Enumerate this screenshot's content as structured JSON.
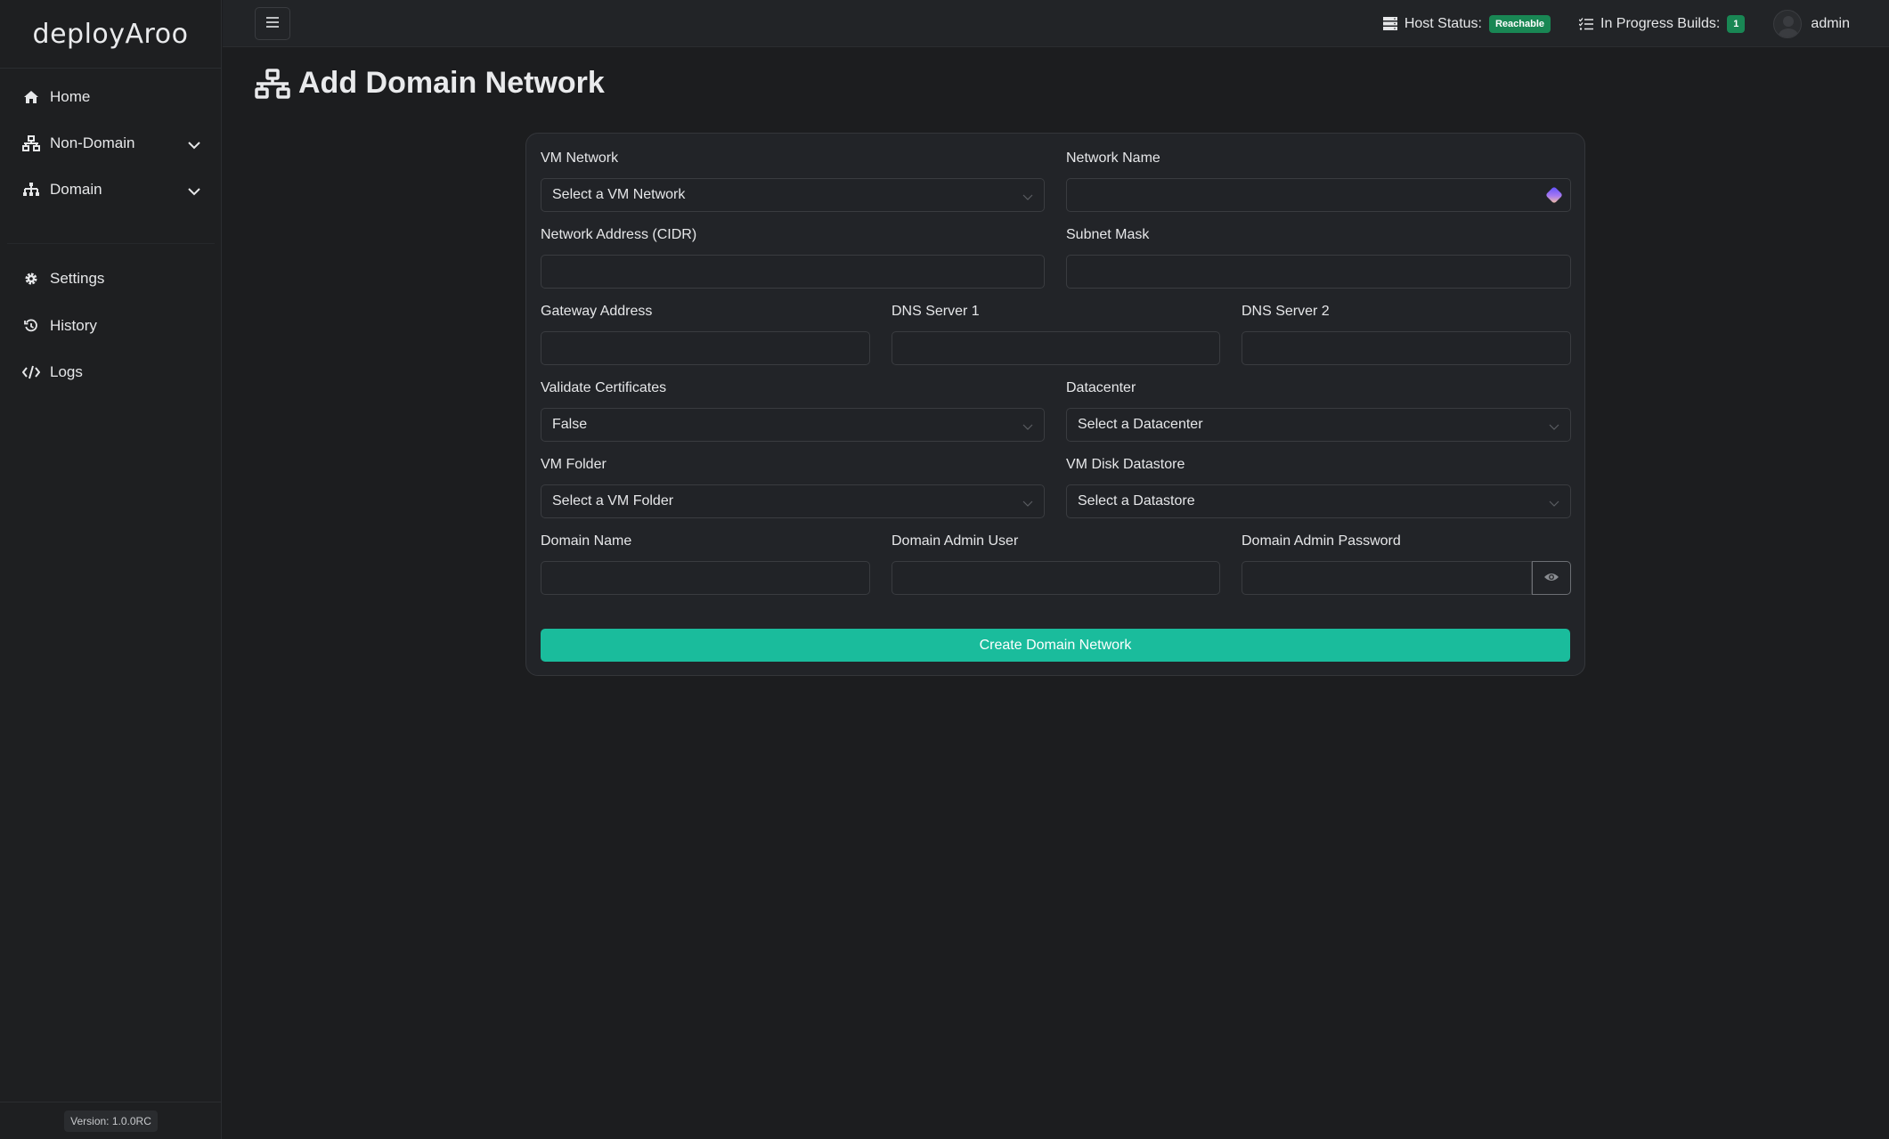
{
  "app": {
    "brand": "deployAroo"
  },
  "sidebar": {
    "items": [
      {
        "label": "Home",
        "icon": "home-icon"
      },
      {
        "label": "Non-Domain",
        "icon": "network-icon",
        "expandable": true
      },
      {
        "label": "Domain",
        "icon": "sitemap-icon",
        "expandable": true
      },
      {
        "label": "Settings",
        "icon": "gear-icon"
      },
      {
        "label": "History",
        "icon": "history-icon"
      },
      {
        "label": "Logs",
        "icon": "code-icon"
      }
    ],
    "version": "Version: 1.0.0RC"
  },
  "topbar": {
    "host_status_label": "Host Status:",
    "host_status_value": "Reachable",
    "builds_label": "In Progress Builds:",
    "builds_count": "1",
    "user": "admin",
    "badge_color": "#198754"
  },
  "page": {
    "title": "Add Domain Network"
  },
  "form": {
    "vm_network": {
      "label": "VM Network",
      "value": "Select a VM Network"
    },
    "network_name": {
      "label": "Network Name",
      "value": ""
    },
    "network_address": {
      "label": "Network Address (CIDR)",
      "value": ""
    },
    "subnet_mask": {
      "label": "Subnet Mask",
      "value": ""
    },
    "gateway": {
      "label": "Gateway Address",
      "value": ""
    },
    "dns1": {
      "label": "DNS Server 1",
      "value": ""
    },
    "dns2": {
      "label": "DNS Server 2",
      "value": ""
    },
    "validate_certs": {
      "label": "Validate Certificates",
      "value": "False"
    },
    "datacenter": {
      "label": "Datacenter",
      "value": "Select a Datacenter"
    },
    "vm_folder": {
      "label": "VM Folder",
      "value": "Select a VM Folder"
    },
    "datastore": {
      "label": "VM Disk Datastore",
      "value": "Select a Datastore"
    },
    "domain_name": {
      "label": "Domain Name",
      "value": ""
    },
    "domain_admin_user": {
      "label": "Domain Admin User",
      "value": ""
    },
    "domain_admin_password": {
      "label": "Domain Admin Password",
      "value": ""
    },
    "submit_label": "Create Domain Network",
    "accent_color": "#1abc9c"
  }
}
